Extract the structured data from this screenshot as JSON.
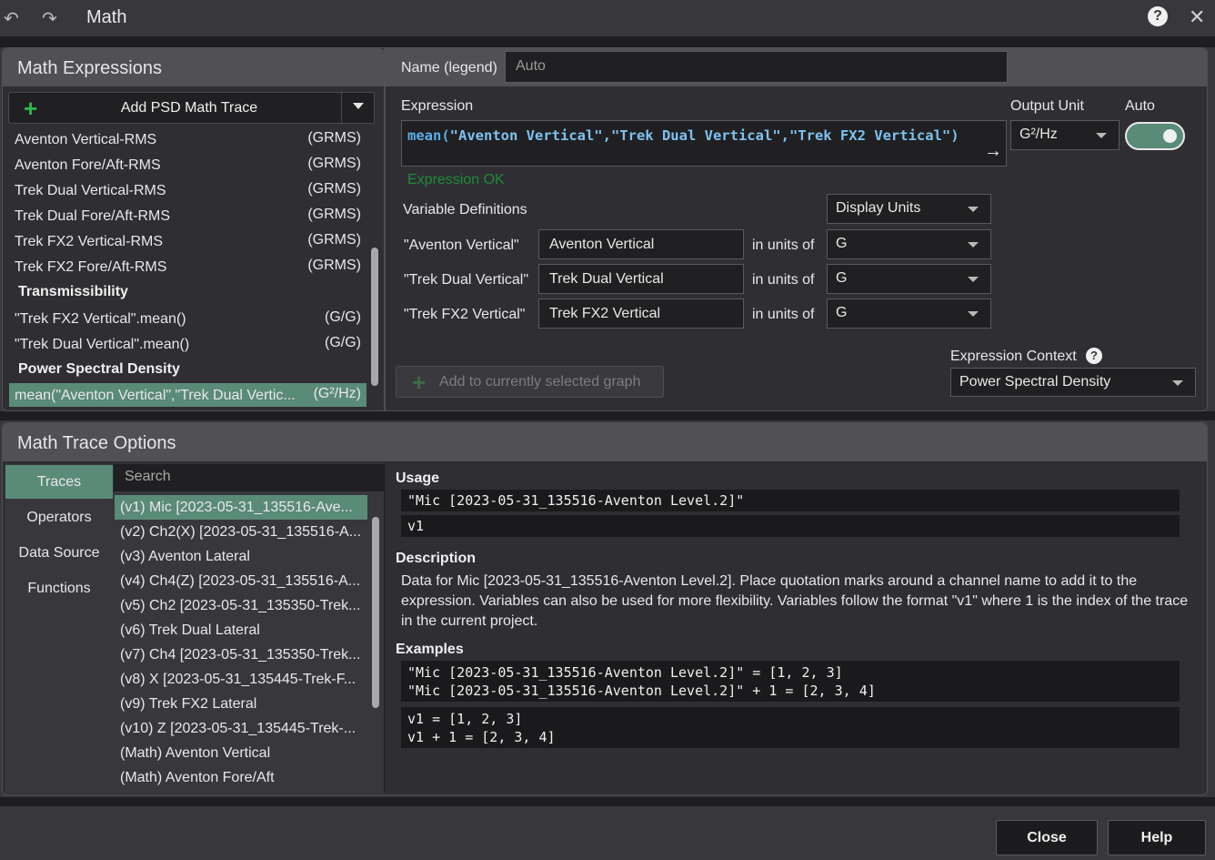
{
  "window": {
    "title": "Math"
  },
  "expressions_panel": {
    "title": "Math Expressions",
    "add_button": "Add PSD Math Trace",
    "items": [
      {
        "name": "Aventon Vertical-RMS",
        "unit": "(GRMS)"
      },
      {
        "name": "Aventon Fore/Aft-RMS",
        "unit": "(GRMS)"
      },
      {
        "name": "Trek Dual Vertical-RMS",
        "unit": "(GRMS)"
      },
      {
        "name": "Trek Dual Fore/Aft-RMS",
        "unit": "(GRMS)"
      },
      {
        "name": "Trek FX2 Vertical-RMS",
        "unit": "(GRMS)"
      },
      {
        "name": "Trek FX2 Fore/Aft-RMS",
        "unit": "(GRMS)"
      }
    ],
    "group_transmissibility": "Transmissibility",
    "trans_items": [
      {
        "name": "\"Trek FX2 Vertical\".mean()",
        "unit": "(G/G)"
      },
      {
        "name": "\"Trek Dual Vertical\".mean()",
        "unit": "(G/G)"
      }
    ],
    "group_psd": "Power Spectral Density",
    "psd_items": [
      {
        "name": "mean(\"Aventon Vertical\",\"Trek Dual Vertic...",
        "unit": "(G²/Hz)"
      }
    ]
  },
  "editor": {
    "name_label": "Name (legend)",
    "name_placeholder": "Auto",
    "expression_label": "Expression",
    "expression_fn": "mean(",
    "expression_args": "\"Aventon Vertical\",\"Trek Dual Vertical\",\"Trek FX2 Vertical\")",
    "expression_status": "Expression OK",
    "output_unit_label": "Output Unit",
    "output_unit": "G²/Hz",
    "auto_label": "Auto",
    "auto_on": true,
    "var_defs_label": "Variable Definitions",
    "display_units": "Display Units",
    "in_units_of": "in units of",
    "variables": [
      {
        "name": "\"Aventon Vertical\"",
        "value": "Aventon Vertical",
        "unit": "G"
      },
      {
        "name": "\"Trek Dual Vertical\"",
        "value": "Trek Dual Vertical",
        "unit": "G"
      },
      {
        "name": "\"Trek FX2 Vertical\"",
        "value": "Trek FX2 Vertical",
        "unit": "G"
      }
    ],
    "add_graph_button": "Add to currently selected graph",
    "context_label": "Expression Context",
    "context_value": "Power Spectral Density"
  },
  "options_panel": {
    "title": "Math Trace Options",
    "categories": [
      "Traces",
      "Operators",
      "Data Source",
      "Functions"
    ],
    "search_placeholder": "Search",
    "traces": [
      "(v1) Mic [2023-05-31_135516-Ave...",
      "(v2) Ch2(X) [2023-05-31_135516-A...",
      "(v3) Aventon Lateral",
      "(v4) Ch4(Z) [2023-05-31_135516-A...",
      "(v5) Ch2 [2023-05-31_135350-Trek...",
      "(v6) Trek Dual Lateral",
      "(v7) Ch4 [2023-05-31_135350-Trek...",
      "(v8) X [2023-05-31_135445-Trek-F...",
      "(v9) Trek FX2 Lateral",
      "(v10) Z [2023-05-31_135445-Trek-...",
      "(Math) Aventon Vertical",
      "(Math) Aventon Fore/Aft"
    ],
    "usage_title": "Usage",
    "usage_line1": "\"Mic [2023-05-31_135516-Aventon Level.2]\"",
    "usage_line2": "v1",
    "description_title": "Description",
    "description": "Data for Mic [2023-05-31_135516-Aventon Level.2]. Place quotation marks around a channel name to add it to the expression. Variables can also be used for more flexibility. Variables follow the format \"v1\" where 1 is the index of the trace in the current project.",
    "examples_title": "Examples",
    "example1_line1": "\"Mic [2023-05-31_135516-Aventon Level.2]\" = [1, 2, 3]",
    "example1_line2": "\"Mic [2023-05-31_135516-Aventon Level.2]\" + 1 = [2, 3, 4]",
    "example2_line1": "v1 = [1, 2, 3]",
    "example2_line2": "v1 + 1 = [2, 3, 4]"
  },
  "footer": {
    "close": "Close",
    "help": "Help"
  },
  "colors": {
    "accent": "#5a8a78",
    "expr_blue": "#7ec2f0",
    "ok_green": "#1f8a3a",
    "plus_green": "#2db84a"
  }
}
